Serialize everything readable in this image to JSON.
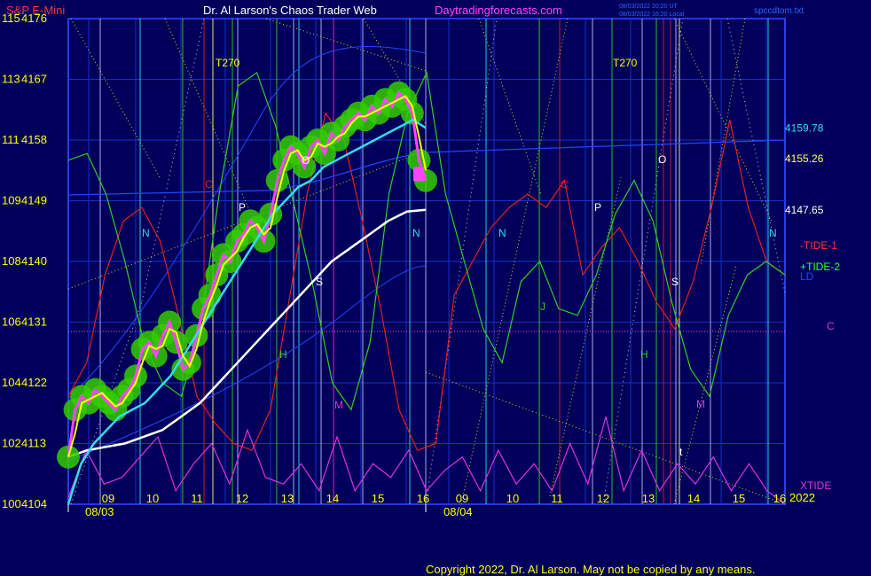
{
  "header": {
    "symbol": "S&P E-Mini",
    "title": "Dr. Al Larson's Chaos Trader Web",
    "site": "Daytradingforecasts.com",
    "stamp_line1": "08/03/2022 20:20 UT",
    "stamp_line2": "08/03/2022 16:20 Local",
    "file": "spccdtom.txt"
  },
  "footer": {
    "copyright": "Copyright 2022, Dr. Al Larson. May not be copied by any means."
  },
  "colors": {
    "background": "#00005a",
    "frame": "#2a3cff",
    "price_line": "#ffff00",
    "price_band": "#33cc00",
    "fast_avg": "#33ddee",
    "slow_avg": "#ffffff",
    "tide1": "#e02020",
    "tide2": "#33cc22",
    "xtide": "#dd33dd",
    "blue_curve": "#2244ff"
  },
  "chart_data": {
    "type": "line",
    "y_left_labels": [
      {
        "tide": "115",
        "price": "4176"
      },
      {
        "tide": "113",
        "price": "4167"
      },
      {
        "tide": "111",
        "price": "4158"
      },
      {
        "tide": "109",
        "price": "4149"
      },
      {
        "tide": "108",
        "price": "4140"
      },
      {
        "tide": "106",
        "price": "4131"
      },
      {
        "tide": "104",
        "price": "4122"
      },
      {
        "tide": "102",
        "price": "4113"
      },
      {
        "tide": "100",
        "price": "4104"
      }
    ],
    "ylim": [
      4104,
      4176
    ],
    "x_hour_labels": [
      "09",
      "10",
      "11",
      "12",
      "13",
      "14",
      "15",
      "16",
      "09",
      "10",
      "11",
      "12",
      "13",
      "14",
      "15",
      "16"
    ],
    "x_date_labels": [
      "08/03",
      "08/04"
    ],
    "year_label": "2022",
    "right_labels": [
      {
        "text": "4159.78",
        "value": 4159.78,
        "color": "#33ddee"
      },
      {
        "text": "4155.26",
        "value": 4155.26,
        "color": "#ffff66"
      },
      {
        "text": "4147.65",
        "value": 4147.65,
        "color": "#ffffff"
      }
    ],
    "tide_labels": [
      {
        "text": "-TIDE-1",
        "color": "#ff3333"
      },
      {
        "text": "+TIDE-2",
        "color": "#33ff33"
      },
      {
        "text": "LD",
        "color": "#2244ff"
      },
      {
        "text": "C",
        "color": "#dd33dd"
      },
      {
        "text": "XTIDE",
        "color": "#dd33dd"
      }
    ],
    "markers": [
      {
        "text": "T270",
        "color": "#ffff00"
      },
      {
        "text": "T270",
        "color": "#ffff00"
      },
      {
        "text": "C",
        "color": "#e02020"
      },
      {
        "text": "C",
        "color": "#e02020"
      },
      {
        "text": "N",
        "color": "#33ddee"
      },
      {
        "text": "N",
        "color": "#33ddee"
      },
      {
        "text": "N",
        "color": "#33ddee"
      },
      {
        "text": "N",
        "color": "#33ddee"
      },
      {
        "text": "P",
        "color": "#ffffff"
      },
      {
        "text": "P",
        "color": "#ffffff"
      },
      {
        "text": "O",
        "color": "#ffffff"
      },
      {
        "text": "O",
        "color": "#ffffff"
      },
      {
        "text": "S",
        "color": "#ffffff"
      },
      {
        "text": "S",
        "color": "#ffffff"
      },
      {
        "text": "H",
        "color": "#33cc22"
      },
      {
        "text": "H",
        "color": "#33cc22"
      },
      {
        "text": "M",
        "color": "#dd33dd"
      },
      {
        "text": "M",
        "color": "#dd33dd"
      },
      {
        "text": "J",
        "color": "#33cc22"
      },
      {
        "text": "t",
        "color": "#ffffff"
      }
    ],
    "series": [
      {
        "name": "price",
        "values": [
          4111,
          4118,
          4120,
          4119,
          4121,
          4120,
          4119,
          4118,
          4120,
          4121,
          4123,
          4127,
          4128,
          4126,
          4129,
          4131,
          4128,
          4124,
          4125,
          4129,
          4133,
          4135,
          4138,
          4141,
          4140,
          4143,
          4144,
          4146,
          4145,
          4143,
          4147,
          4152,
          4155,
          4157,
          4156,
          4154,
          4157,
          4158,
          4156,
          4159,
          4158,
          4160,
          4161,
          4162,
          4161,
          4163,
          4162,
          4164,
          4163,
          4165,
          4164,
          4162,
          4155,
          4152
        ]
      },
      {
        "name": "fast average",
        "values": [
          4104,
          4110,
          4113,
          4115,
          4117,
          4118,
          4119,
          4121,
          4123,
          4126,
          4129,
          4132,
          4135,
          4138,
          4141,
          4144,
          4147,
          4149,
          4151,
          4152,
          4154,
          4155,
          4156,
          4157,
          4158,
          4159,
          4160,
          4161,
          4159.8
        ]
      },
      {
        "name": "slow average",
        "values": [
          4111,
          4112,
          4112.5,
          4113,
          4114,
          4115,
          4117,
          4119,
          4122,
          4125,
          4128,
          4131,
          4134,
          4137,
          4140,
          4142,
          4144,
          4146,
          4147.4,
          4147.65
        ]
      },
      {
        "name": "-TIDE-1",
        "values": [
          4120,
          4125,
          4138,
          4146,
          4148,
          4143,
          4132,
          4120,
          4116,
          4113,
          4112,
          4118,
          4134,
          4150,
          4162,
          4158,
          4146,
          4133,
          4118,
          4112,
          4113,
          4135,
          4140,
          4145,
          4148,
          4150,
          4148,
          4152,
          4138,
          4142,
          4145,
          4140,
          4134,
          4130,
          4137,
          4148,
          4161,
          4148,
          4140,
          4138
        ]
      },
      {
        "name": "+TIDE-2",
        "values": [
          4155,
          4156,
          4150,
          4140,
          4128,
          4122,
          4120,
          4130,
          4150,
          4166,
          4168,
          4160,
          4148,
          4136,
          4122,
          4118,
          4128,
          4150,
          4162,
          4168,
          4150,
          4140,
          4130,
          4125,
          4137,
          4140,
          4133,
          4132,
          4138,
          4147,
          4152,
          4146,
          4134,
          4124,
          4120,
          4132,
          4138,
          4140,
          4138
        ]
      },
      {
        "name": "XTIDE",
        "values": [
          4105,
          4112,
          4107,
          4108,
          4111,
          4114,
          4106,
          4110,
          4113,
          4107,
          4115,
          4108,
          4107,
          4110,
          4106,
          4114,
          4106,
          4110,
          4108,
          4112,
          4106,
          4109,
          4111,
          4106,
          4112,
          4107,
          4110,
          4106,
          4113,
          4107,
          4117,
          4106,
          4112,
          4106,
          4110,
          4107,
          4111,
          4106,
          4110,
          4106,
          4104
        ]
      }
    ]
  }
}
